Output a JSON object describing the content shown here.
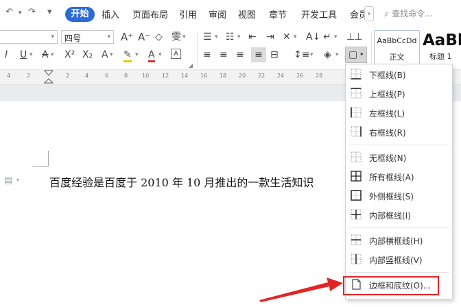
{
  "quick_access": {
    "undo": "↶",
    "redo": "↷",
    "customize": "▾"
  },
  "tabs": [
    {
      "label": "插入"
    },
    {
      "label": "页面布局"
    },
    {
      "label": "引用"
    },
    {
      "label": "审阅"
    },
    {
      "label": "视图"
    },
    {
      "label": "章节"
    },
    {
      "label": "开发工具"
    },
    {
      "label": "会员"
    }
  ],
  "active_tab": "开始",
  "search": {
    "placeholder": "查找命令..."
  },
  "font": {
    "size": "四号"
  },
  "styles": {
    "normal_preview": "AaBbCcDd",
    "normal_label": "正文",
    "heading_preview": "AaBb",
    "heading_label": "标题 1"
  },
  "ruler_numbers": [
    "4",
    "2",
    "2",
    "4",
    "6",
    "8",
    "10",
    "12",
    "14",
    "16",
    "18",
    "20",
    "22",
    "24",
    "26",
    "28"
  ],
  "document": {
    "text": "百度经验是百度于 2010 年 10 月推出的一款生活知识"
  },
  "border_menu": {
    "items": [
      {
        "label": "下框线(B)"
      },
      {
        "label": "上框线(P)"
      },
      {
        "label": "左框线(L)"
      },
      {
        "label": "右框线(R)"
      },
      {
        "label": "无框线(N)"
      },
      {
        "label": "所有框线(A)"
      },
      {
        "label": "外侧框线(S)"
      },
      {
        "label": "内部框线(I)"
      },
      {
        "label": "内部横框线(H)"
      },
      {
        "label": "内部竖框线(V)"
      },
      {
        "label": "边框和底纹(O)..."
      }
    ]
  },
  "colors": {
    "accent": "#2b6bd6",
    "annotation_red": "#e32424"
  }
}
